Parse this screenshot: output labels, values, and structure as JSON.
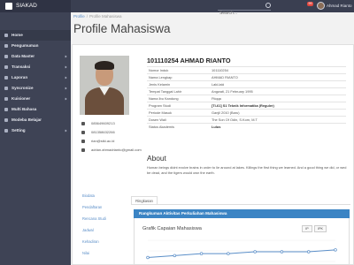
{
  "app": {
    "title": "SIAKAD"
  },
  "topbar": {
    "search_placeholder": "Search...",
    "notification_count": "99",
    "user_name": "Ahmad Rianto"
  },
  "sidebar": {
    "items": [
      {
        "label": "Home"
      },
      {
        "label": "Pengumuman"
      },
      {
        "label": "Data Master"
      },
      {
        "label": "Transaksi"
      },
      {
        "label": "Laporan"
      },
      {
        "label": "Syncronize"
      },
      {
        "label": "Kuisioner"
      },
      {
        "label": "Multi Bahasa"
      },
      {
        "label": "Modeba Belajar"
      },
      {
        "label": "Setting"
      }
    ]
  },
  "breadcrumb": {
    "items": [
      "Profile",
      "Profile Mahasiswa"
    ]
  },
  "page": {
    "title": "Profile Mahasiswa"
  },
  "profile": {
    "heading": "101110254 AHMAD RIANTO",
    "rows": [
      {
        "label": "Nomor Induk",
        "value": "101110254"
      },
      {
        "label": "Nama Lengkap",
        "value": "AHMAD RIANTO"
      },
      {
        "label": "Jenis Kelamin",
        "value": "Laki-laki"
      },
      {
        "label": "Tempat Tanggal Lahir",
        "value": "Angwati, 21 February 1995"
      },
      {
        "label": "Nama Ibu Kandung",
        "value": "Ftiqqa"
      },
      {
        "label": "Program Studi",
        "value": "[TI-61] S1 Teknik Informatika (Reguler)"
      },
      {
        "label": "Periode Masuk",
        "value": "Ganjil 2010 (Baru)"
      },
      {
        "label": "Dosen Wali",
        "value": "The Son Of Odin, S.Kom, M.T"
      },
      {
        "label": "Status Akademis",
        "value": "Lulus"
      }
    ]
  },
  "contacts": [
    {
      "icon": "phone-icon",
      "text": "085649609213"
    },
    {
      "icon": "mobile-icon",
      "text": "081358632266"
    },
    {
      "icon": "mail-icon",
      "text": "rian@stki.ac.id"
    },
    {
      "icon": "mail-icon",
      "text": "adrian.ahmadrianto@gmail.com"
    }
  ],
  "about": {
    "title": "About",
    "text": "Human beings didnt evolve brains in order to lie around at lakes. Killings the first thing we learned. And a good thing we did, or wed be dead, and the tigers would own the earth."
  },
  "side_menu": [
    "Biodata",
    "Pendaftaran",
    "Rencana Studi",
    "Jadwal",
    "Kehadiran",
    "Nilai"
  ],
  "tabs": [
    {
      "label": "Ringkasan"
    }
  ],
  "summary": {
    "title": "Rangkuman Aktivitas Perkuliahan Mahasiswa",
    "chart_title": "Grafik Capaian Mahasiswa",
    "buttons": [
      "IP",
      "IPK"
    ]
  },
  "chart_data": {
    "type": "line",
    "series": [
      {
        "values": [
          3.35,
          3.4,
          3.45,
          3.45,
          3.5,
          3.5,
          3.5,
          3.55
        ]
      }
    ],
    "ylim": [
      3.2,
      3.8
    ],
    "legend": "top-right",
    "colors": [
      "#5a8ec8"
    ]
  },
  "colors": {
    "topbar": "#3a3f51",
    "sidebar": "#3e4355",
    "accent": "#3b84c4",
    "link": "#5a8ec8",
    "badge": "#e2473f"
  }
}
